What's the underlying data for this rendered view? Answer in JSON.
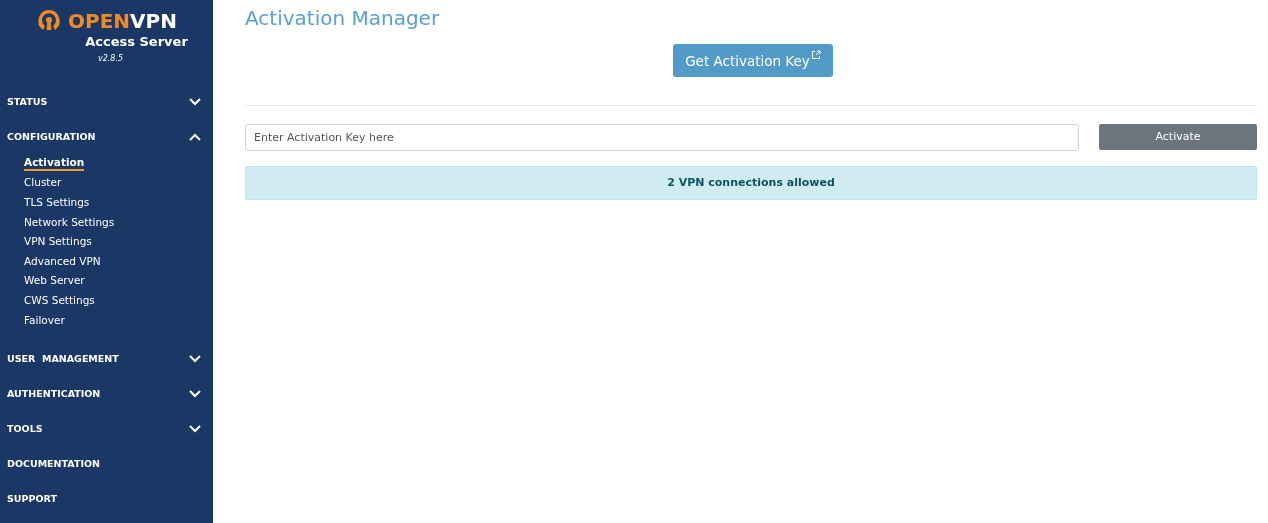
{
  "logo": {
    "brand_first": "OPEN",
    "brand_second": "VPN",
    "product": "Access Server",
    "version": "v2.8.5"
  },
  "sidebar": {
    "sections": [
      {
        "label": "STATUS",
        "kind": "collapsible",
        "expanded": false
      },
      {
        "label": "CONFIGURATION",
        "kind": "collapsible",
        "expanded": true,
        "items": [
          {
            "label": "Activation",
            "selected": true
          },
          {
            "label": "Cluster",
            "selected": false
          },
          {
            "label": "TLS Settings",
            "selected": false
          },
          {
            "label": "Network Settings",
            "selected": false
          },
          {
            "label": "VPN Settings",
            "selected": false
          },
          {
            "label": "Advanced VPN",
            "selected": false
          },
          {
            "label": "Web Server",
            "selected": false
          },
          {
            "label": "CWS Settings",
            "selected": false
          },
          {
            "label": "Failover",
            "selected": false
          }
        ]
      },
      {
        "label": "USER  MANAGEMENT",
        "kind": "collapsible",
        "expanded": false
      },
      {
        "label": "AUTHENTICATION",
        "kind": "collapsible",
        "expanded": false
      },
      {
        "label": "TOOLS",
        "kind": "collapsible",
        "expanded": false
      },
      {
        "label": "DOCUMENTATION",
        "kind": "link"
      },
      {
        "label": "SUPPORT",
        "kind": "link"
      }
    ]
  },
  "main": {
    "title": "Activation Manager",
    "get_key_button": "Get Activation Key",
    "key_field": {
      "placeholder": "Enter Activation Key here"
    },
    "activate_button": "Activate",
    "notice": "2 VPN connections allowed"
  }
}
